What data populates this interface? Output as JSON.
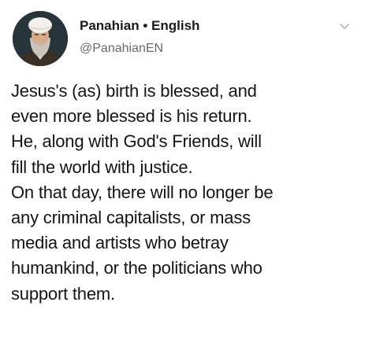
{
  "header": {
    "display_name": "Panahian",
    "separator": "•",
    "language_label": "English",
    "handle": "@PanahianEN",
    "avatar_icon": "profile-photo",
    "menu_icon": "chevron-down-icon"
  },
  "tweet": {
    "lines": [
      "Jesus's (as) birth is blessed, and",
      "even more blessed is his return.",
      "He, along with God's Friends, will",
      "fill the world with justice.",
      "On that day, there will no longer be",
      "any criminal capitalists, or mass",
      "media and artists who betray",
      "humankind, or the politicians who",
      "support them."
    ]
  },
  "colors": {
    "background": "#ffffff",
    "name_text": "#1a1a1a",
    "handle_text": "#6a6a6a",
    "body_text": "#141414",
    "chevron": "#b8b8b8"
  }
}
